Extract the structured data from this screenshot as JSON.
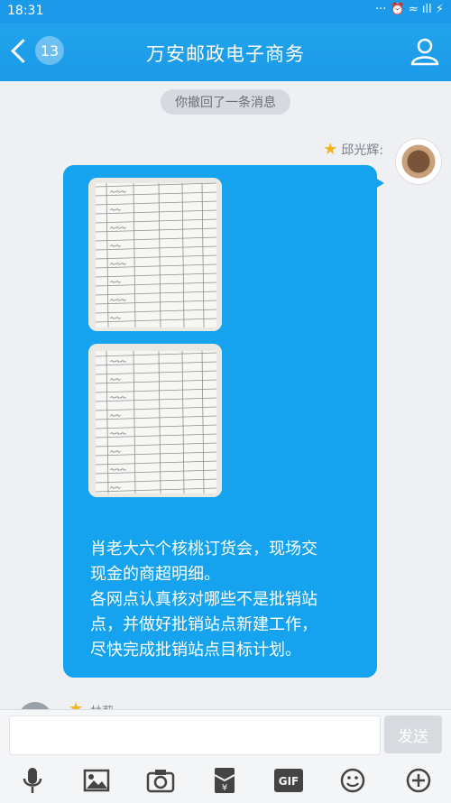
{
  "status_bar": {
    "time": "18:31",
    "right_text": "··· ⏰ ≈ ıll ⚡"
  },
  "header": {
    "back_count": "13",
    "title": "万安邮政电子商务"
  },
  "chat": {
    "recall_notice": "你撤回了一条消息",
    "sender_name": "邱光辉:",
    "message_lines": [
      "肖老大六个核桃订货会，现场交",
      "现金的商超明细。",
      "各网点认真核对哪些不是批销站",
      "点，并做好批销站点新建工作，",
      "尽快完成批销站点目标计划。"
    ],
    "next_sender_partial": "林莉"
  },
  "input": {
    "placeholder": "",
    "send_label": "发送"
  },
  "toolbar": {
    "icons": [
      "microphone-icon",
      "image-icon",
      "camera-icon",
      "red-packet-icon",
      "gif-icon",
      "emoji-icon",
      "plus-icon"
    ],
    "gif_label": "GIF"
  },
  "colors": {
    "accent": "#1a9ae8",
    "bubble": "#15a3ef",
    "star": "#f3b51b"
  }
}
